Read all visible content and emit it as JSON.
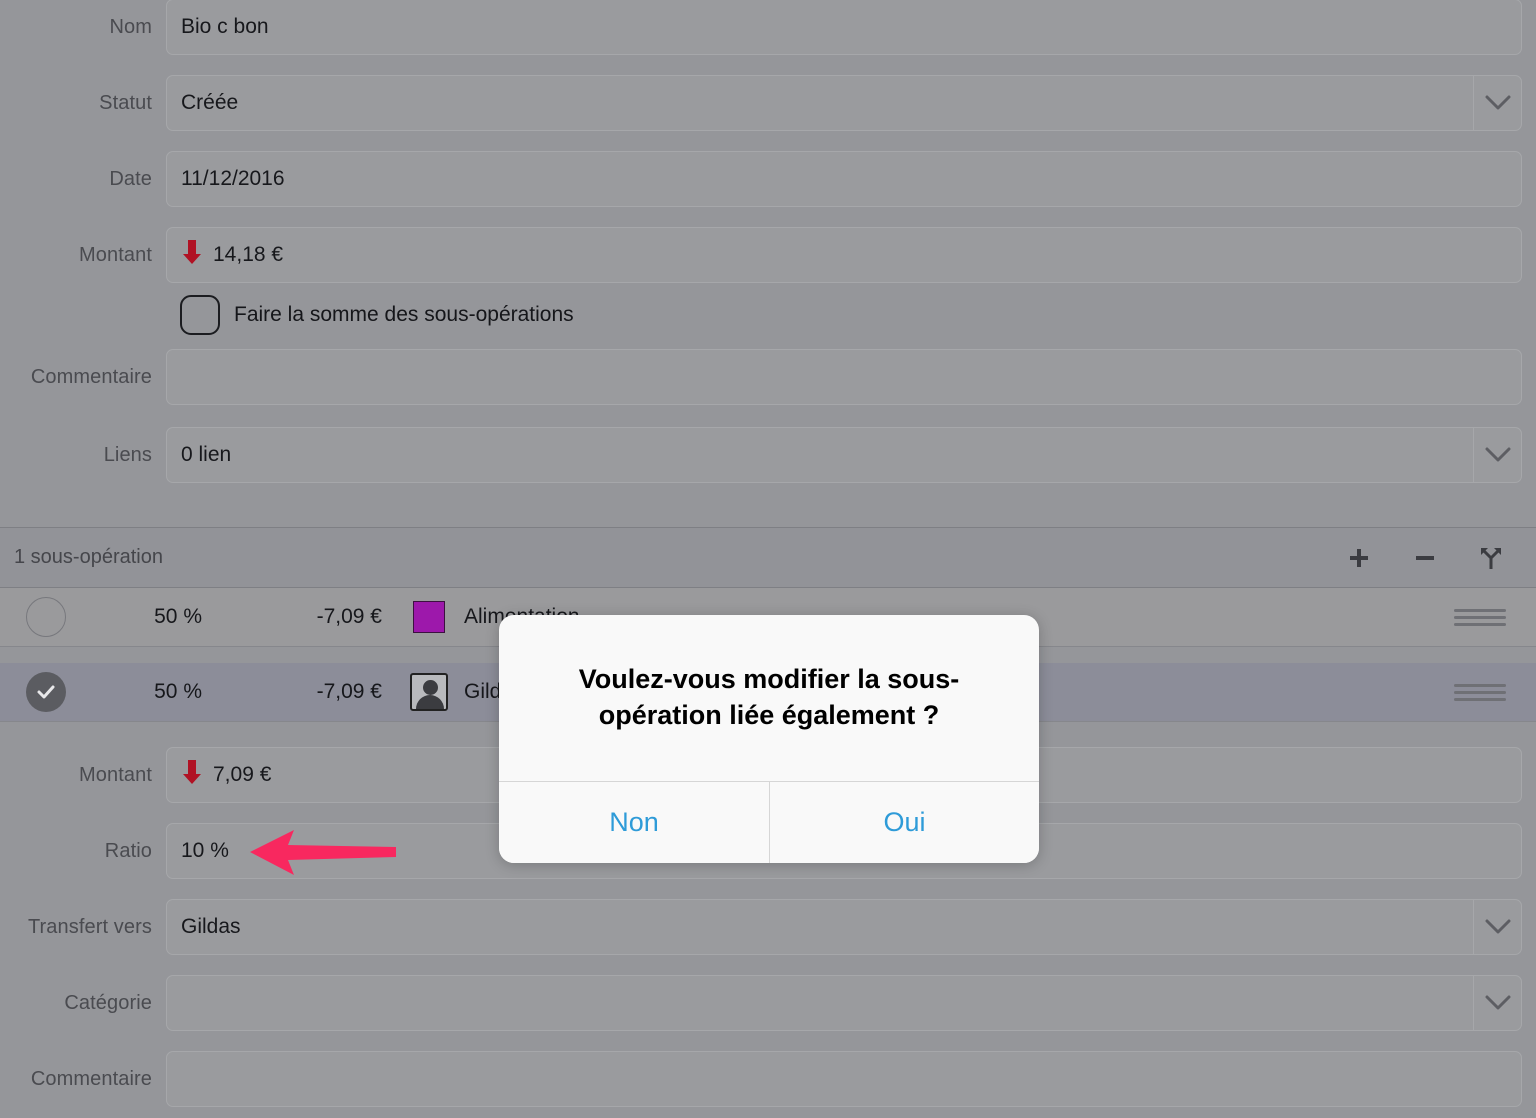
{
  "top_form": {
    "fields": [
      {
        "label": "Nom",
        "value": "Bio c bon",
        "type": "text",
        "chevron": false,
        "arrow": false
      },
      {
        "label": "Statut",
        "value": "Créée",
        "type": "select",
        "chevron": true,
        "arrow": false
      },
      {
        "label": "Date",
        "value": "11/12/2016",
        "type": "text",
        "chevron": false,
        "arrow": false
      },
      {
        "label": "Montant",
        "value": "14,18 €",
        "type": "amount",
        "chevron": false,
        "arrow": true
      }
    ],
    "checkbox": {
      "label": "Faire la somme des sous-opérations",
      "checked": false
    },
    "fields2": [
      {
        "label": "Commentaire",
        "value": "",
        "type": "text",
        "chevron": false,
        "arrow": false
      },
      {
        "label": "Liens",
        "value": "0 lien",
        "type": "select",
        "chevron": true,
        "arrow": false
      }
    ]
  },
  "subop_bar": {
    "title": "1 sous-opération",
    "tools": [
      {
        "name": "add-suboperation-button",
        "icon": "plus-icon"
      },
      {
        "name": "remove-suboperation-button",
        "icon": "minus-icon"
      },
      {
        "name": "split-suboperation-button",
        "icon": "split-fork-icon"
      }
    ]
  },
  "rows": [
    {
      "selected": false,
      "check_state": "unchecked",
      "percent": "50 %",
      "amount": "-7,09 €",
      "icon_type": "color-swatch",
      "icon_color": "#9d18ab",
      "name": "Alimentation"
    },
    {
      "selected": true,
      "check_state": "checked",
      "percent": "50 %",
      "amount": "-7,09 €",
      "icon_type": "avatar",
      "icon_color": "",
      "name": "Gildas"
    }
  ],
  "bottom_form": {
    "fields": [
      {
        "label": "Montant",
        "value": "7,09 €",
        "type": "amount",
        "chevron": false,
        "arrow": true
      },
      {
        "label": "Ratio",
        "value": "10 %",
        "type": "text",
        "chevron": false,
        "arrow": false
      },
      {
        "label": "Transfert vers",
        "value": "Gildas",
        "type": "select",
        "chevron": true,
        "arrow": false
      },
      {
        "label": "Catégorie",
        "value": "",
        "type": "select",
        "chevron": true,
        "arrow": false
      },
      {
        "label": "Commentaire",
        "value": "",
        "type": "text",
        "chevron": false,
        "arrow": false
      }
    ]
  },
  "alert": {
    "message": "Voulez-vous modifier la sous-opération liée également ?",
    "buttons": [
      {
        "label": "Non",
        "name": "alert-button-non"
      },
      {
        "label": "Oui",
        "name": "alert-button-oui"
      }
    ],
    "accent_color": "#2e9bd8"
  },
  "annotation": {
    "arrow_color": "#f8285f",
    "points_at": "Ratio"
  }
}
